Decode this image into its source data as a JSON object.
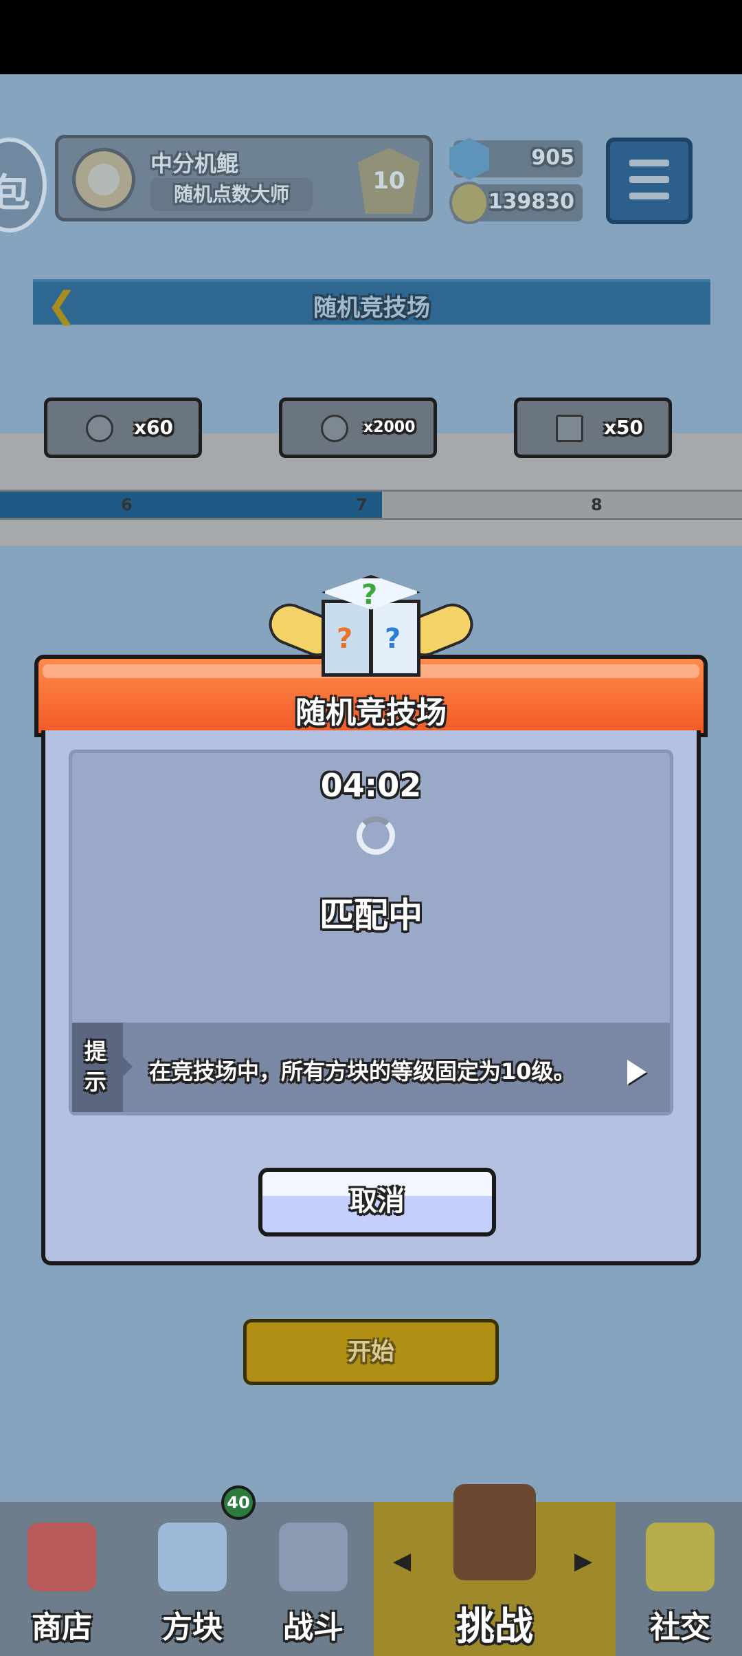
{
  "player": {
    "name": "中分机鲲",
    "title": "随机点数大师",
    "rank_level": "10"
  },
  "currency": {
    "gems": "905",
    "coins": "139830"
  },
  "side_glyph": "包",
  "mode_header": {
    "title": "随机竞技场"
  },
  "rewards": [
    {
      "amount": "x60",
      "icon": "dice-icon"
    },
    {
      "amount": "x2000",
      "icon": "coin-icon"
    },
    {
      "amount": "x50",
      "icon": "gem-icon"
    }
  ],
  "track": {
    "ticks": [
      "6",
      "7",
      "8"
    ],
    "progress_fraction": 0.515
  },
  "start_button": "开始",
  "nav": {
    "items": [
      {
        "label": "商店",
        "icon": "shop-icon"
      },
      {
        "label": "方块",
        "icon": "dice-block-icon",
        "badge": "40"
      },
      {
        "label": "战斗",
        "icon": "battle-icon"
      },
      {
        "label": "挑战",
        "icon": "challenge-icon",
        "active": true
      },
      {
        "label": "社交",
        "icon": "social-icon"
      }
    ]
  },
  "modal": {
    "title": "随机竞技场",
    "timer": "04:02",
    "status": "匹配中",
    "tip_label": "提示",
    "tip_text": "在竞技场中，所有方块的等级固定为10级。",
    "cancel_label": "取消",
    "cube_marks": [
      "?",
      "?",
      "?"
    ]
  },
  "colors": {
    "header_orange": "#f25a28",
    "panel_blue": "#b4c1e0",
    "nav_active": "#9e8a2b",
    "progress_blue": "#1e5a86"
  }
}
